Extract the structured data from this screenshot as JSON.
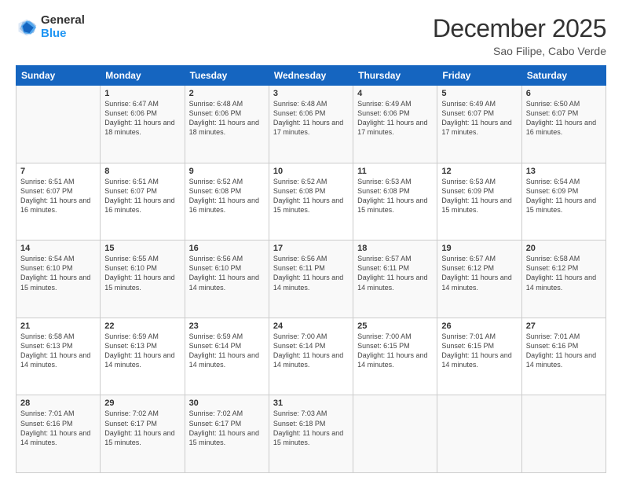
{
  "logo": {
    "general": "General",
    "blue": "Blue"
  },
  "title": "December 2025",
  "subtitle": "Sao Filipe, Cabo Verde",
  "days_header": [
    "Sunday",
    "Monday",
    "Tuesday",
    "Wednesday",
    "Thursday",
    "Friday",
    "Saturday"
  ],
  "weeks": [
    [
      {
        "day": "",
        "info": ""
      },
      {
        "day": "1",
        "info": "Sunrise: 6:47 AM\nSunset: 6:06 PM\nDaylight: 11 hours\nand 18 minutes."
      },
      {
        "day": "2",
        "info": "Sunrise: 6:48 AM\nSunset: 6:06 PM\nDaylight: 11 hours\nand 18 minutes."
      },
      {
        "day": "3",
        "info": "Sunrise: 6:48 AM\nSunset: 6:06 PM\nDaylight: 11 hours\nand 17 minutes."
      },
      {
        "day": "4",
        "info": "Sunrise: 6:49 AM\nSunset: 6:06 PM\nDaylight: 11 hours\nand 17 minutes."
      },
      {
        "day": "5",
        "info": "Sunrise: 6:49 AM\nSunset: 6:07 PM\nDaylight: 11 hours\nand 17 minutes."
      },
      {
        "day": "6",
        "info": "Sunrise: 6:50 AM\nSunset: 6:07 PM\nDaylight: 11 hours\nand 16 minutes."
      }
    ],
    [
      {
        "day": "7",
        "info": "Sunrise: 6:51 AM\nSunset: 6:07 PM\nDaylight: 11 hours\nand 16 minutes."
      },
      {
        "day": "8",
        "info": "Sunrise: 6:51 AM\nSunset: 6:07 PM\nDaylight: 11 hours\nand 16 minutes."
      },
      {
        "day": "9",
        "info": "Sunrise: 6:52 AM\nSunset: 6:08 PM\nDaylight: 11 hours\nand 16 minutes."
      },
      {
        "day": "10",
        "info": "Sunrise: 6:52 AM\nSunset: 6:08 PM\nDaylight: 11 hours\nand 15 minutes."
      },
      {
        "day": "11",
        "info": "Sunrise: 6:53 AM\nSunset: 6:08 PM\nDaylight: 11 hours\nand 15 minutes."
      },
      {
        "day": "12",
        "info": "Sunrise: 6:53 AM\nSunset: 6:09 PM\nDaylight: 11 hours\nand 15 minutes."
      },
      {
        "day": "13",
        "info": "Sunrise: 6:54 AM\nSunset: 6:09 PM\nDaylight: 11 hours\nand 15 minutes."
      }
    ],
    [
      {
        "day": "14",
        "info": "Sunrise: 6:54 AM\nSunset: 6:10 PM\nDaylight: 11 hours\nand 15 minutes."
      },
      {
        "day": "15",
        "info": "Sunrise: 6:55 AM\nSunset: 6:10 PM\nDaylight: 11 hours\nand 15 minutes."
      },
      {
        "day": "16",
        "info": "Sunrise: 6:56 AM\nSunset: 6:10 PM\nDaylight: 11 hours\nand 14 minutes."
      },
      {
        "day": "17",
        "info": "Sunrise: 6:56 AM\nSunset: 6:11 PM\nDaylight: 11 hours\nand 14 minutes."
      },
      {
        "day": "18",
        "info": "Sunrise: 6:57 AM\nSunset: 6:11 PM\nDaylight: 11 hours\nand 14 minutes."
      },
      {
        "day": "19",
        "info": "Sunrise: 6:57 AM\nSunset: 6:12 PM\nDaylight: 11 hours\nand 14 minutes."
      },
      {
        "day": "20",
        "info": "Sunrise: 6:58 AM\nSunset: 6:12 PM\nDaylight: 11 hours\nand 14 minutes."
      }
    ],
    [
      {
        "day": "21",
        "info": "Sunrise: 6:58 AM\nSunset: 6:13 PM\nDaylight: 11 hours\nand 14 minutes."
      },
      {
        "day": "22",
        "info": "Sunrise: 6:59 AM\nSunset: 6:13 PM\nDaylight: 11 hours\nand 14 minutes."
      },
      {
        "day": "23",
        "info": "Sunrise: 6:59 AM\nSunset: 6:14 PM\nDaylight: 11 hours\nand 14 minutes."
      },
      {
        "day": "24",
        "info": "Sunrise: 7:00 AM\nSunset: 6:14 PM\nDaylight: 11 hours\nand 14 minutes."
      },
      {
        "day": "25",
        "info": "Sunrise: 7:00 AM\nSunset: 6:15 PM\nDaylight: 11 hours\nand 14 minutes."
      },
      {
        "day": "26",
        "info": "Sunrise: 7:01 AM\nSunset: 6:15 PM\nDaylight: 11 hours\nand 14 minutes."
      },
      {
        "day": "27",
        "info": "Sunrise: 7:01 AM\nSunset: 6:16 PM\nDaylight: 11 hours\nand 14 minutes."
      }
    ],
    [
      {
        "day": "28",
        "info": "Sunrise: 7:01 AM\nSunset: 6:16 PM\nDaylight: 11 hours\nand 14 minutes."
      },
      {
        "day": "29",
        "info": "Sunrise: 7:02 AM\nSunset: 6:17 PM\nDaylight: 11 hours\nand 15 minutes."
      },
      {
        "day": "30",
        "info": "Sunrise: 7:02 AM\nSunset: 6:17 PM\nDaylight: 11 hours\nand 15 minutes."
      },
      {
        "day": "31",
        "info": "Sunrise: 7:03 AM\nSunset: 6:18 PM\nDaylight: 11 hours\nand 15 minutes."
      },
      {
        "day": "",
        "info": ""
      },
      {
        "day": "",
        "info": ""
      },
      {
        "day": "",
        "info": ""
      }
    ]
  ]
}
